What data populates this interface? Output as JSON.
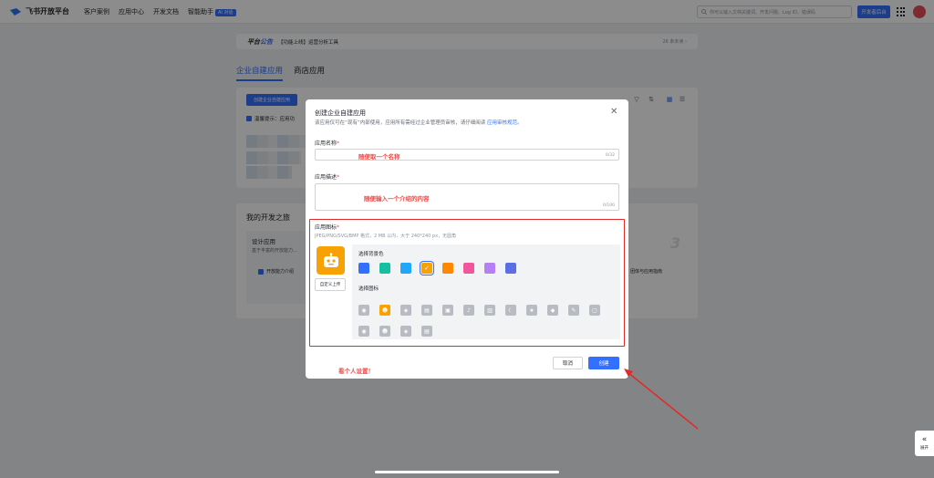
{
  "nav": {
    "logo": "飞书开放平台",
    "items": [
      "客户案例",
      "应用中心",
      "开发文档",
      "智能助手"
    ],
    "beta_badge": "AI 对话",
    "search_placeholder": "你可以输入文档关键词、开发问题、Log ID、错误码",
    "console_button": "开发者后台"
  },
  "announcement": {
    "title_a": "平台",
    "title_b": "公告",
    "text": "【功能上线】运营分析工具",
    "more": "26 条未读 ›"
  },
  "tabs": [
    "企业自建应用",
    "商店应用"
  ],
  "panel": {
    "create_button": "创建企业自建应用",
    "hint": "温馨提示：应用功"
  },
  "journey": {
    "title": "我的开发之旅",
    "card_title": "设计应用",
    "card_desc": "基于丰富的开放能力...",
    "card_link": "开放能力介绍",
    "right_link": "团体与应用指南",
    "step_number": "3"
  },
  "modal": {
    "title": "创建企业自建应用",
    "subtitle": "该应用仅可在“现有”内部使用，应用所有需经过企业管理员审核，请仔细阅读 ",
    "subtitle_link": "应用审核规范",
    "subtitle_end": "。",
    "name_label": "应用名称",
    "name_counter": "0/32",
    "name_note": "随便取一个名称",
    "desc_label": "应用描述",
    "desc_counter": "0/100",
    "desc_note": "随便输入一个介绍的内容",
    "icon_label": "应用图标",
    "icon_hint": "JPEG/PNG/SVG/BMP 格式，2 MB 以内，大于 240*240 px，无圆角",
    "upload_button": "自定义上传",
    "bg_color_label": "选择背景色",
    "icon_pick_label": "选择图标",
    "cancel_button": "取消",
    "create_button": "创建",
    "annotation": "看个人设置！"
  },
  "colors": {
    "swatches": [
      "#3370ff",
      "#14c0a0",
      "#1ea7fd",
      "#f7a102",
      "#ff8800",
      "#f0559d",
      "#b680f5",
      "#5c6ee6"
    ],
    "selected_swatch_index": 3,
    "accent": "#3370ff",
    "annotation_red": "#e02b2b"
  },
  "icons": {
    "row1": [
      "robot-icon",
      "robot-face-icon",
      "compass-icon",
      "document-icon",
      "briefcase-icon",
      "bell-icon",
      "book-icon",
      "moon-icon",
      "star-icon",
      "tag-icon",
      "wrench-icon",
      "file-icon"
    ],
    "row2": [
      "shield-icon",
      "calendar-icon",
      "people-icon",
      "smile-icon"
    ],
    "selected_index": 1
  },
  "expand": {
    "label": "展开"
  }
}
